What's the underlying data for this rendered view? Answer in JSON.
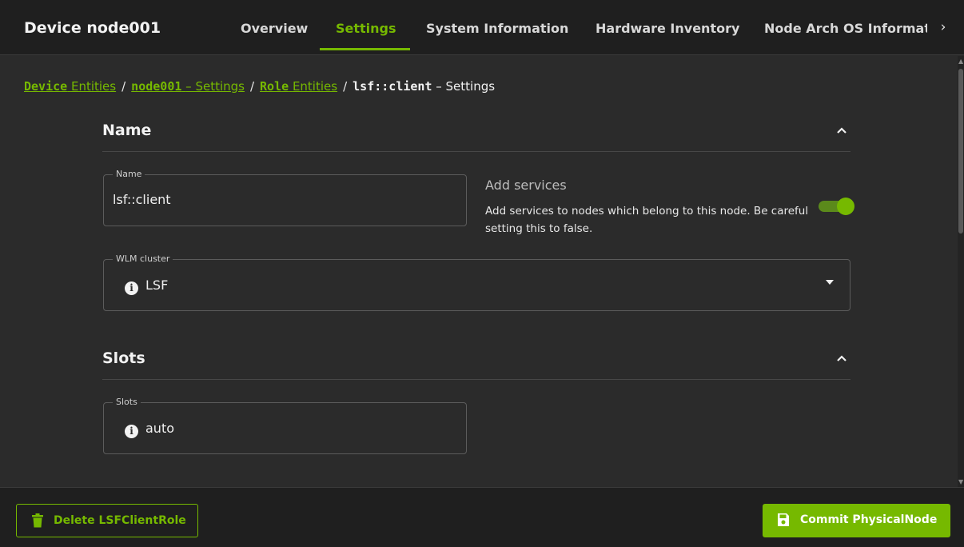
{
  "header": {
    "title": "Device node001",
    "tabs": [
      {
        "label": "Overview"
      },
      {
        "label": "Settings"
      },
      {
        "label": "System Information"
      },
      {
        "label": "Hardware Inventory"
      },
      {
        "label": "Node Arch OS Informatio"
      }
    ],
    "active_tab": "Settings",
    "more_icon": "chevron-right-icon"
  },
  "breadcrumb": {
    "crumb1_bold": "Device",
    "crumb1_text": "Entities",
    "sep": "/",
    "crumb2_bold": "node001",
    "crumb2_text": "– Settings",
    "crumb3_bold": "Role",
    "crumb3_text": "Entities",
    "current_bold": "lsf::client",
    "current_text": "– Settings"
  },
  "sections": {
    "name": {
      "title": "Name",
      "name_field": {
        "legend": "Name",
        "value": "lsf::client"
      },
      "add_services": {
        "title": "Add services",
        "description": "Add services to nodes which belong to this node. Be careful setting this to false.",
        "enabled": true
      },
      "wlm_field": {
        "legend": "WLM cluster",
        "value": "LSF"
      }
    },
    "slots": {
      "title": "Slots",
      "slots_field": {
        "legend": "Slots",
        "value": "auto"
      }
    }
  },
  "footer": {
    "delete_label": "Delete LSFClientRole",
    "commit_label": "Commit PhysicalNode"
  },
  "colors": {
    "accent": "#76b900",
    "background": "#2b2b2b",
    "bar": "#1f1f1f"
  }
}
